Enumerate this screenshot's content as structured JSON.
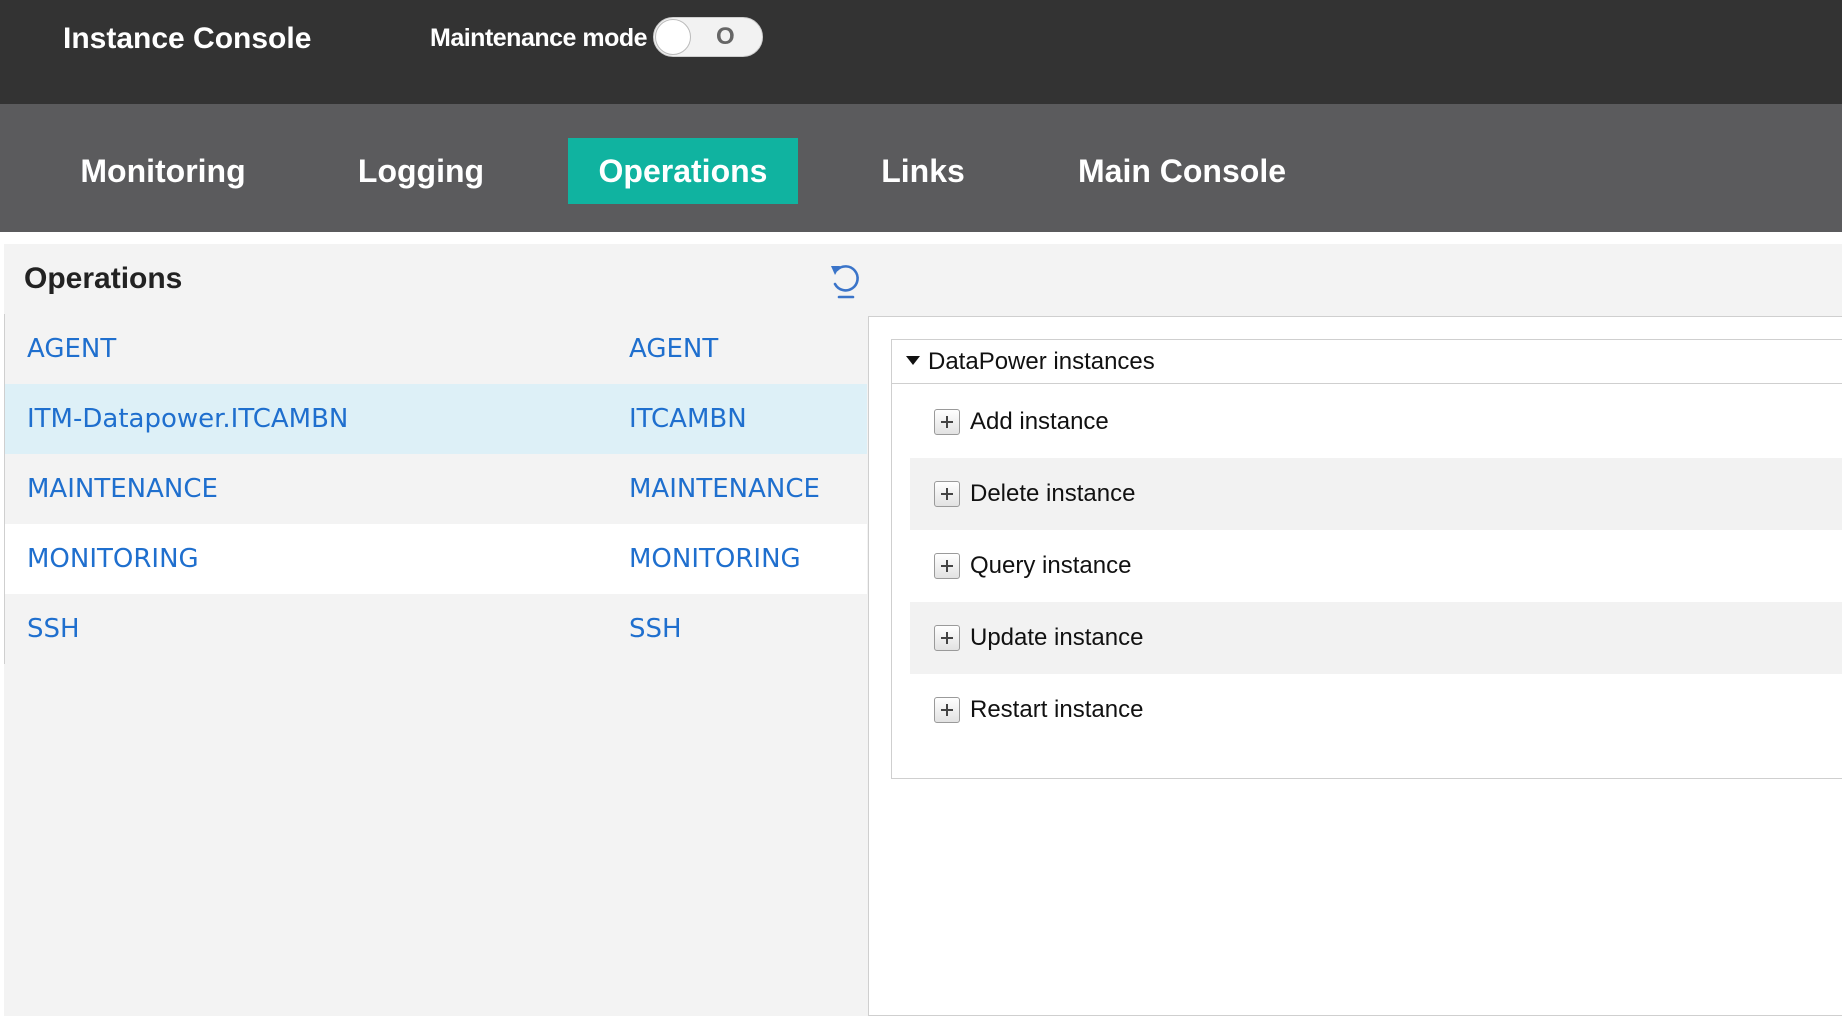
{
  "header": {
    "title": "Instance Console",
    "maintenance_label": "Maintenance mode",
    "maintenance_toggle_state": "O"
  },
  "nav": {
    "tabs": [
      {
        "label": "Monitoring"
      },
      {
        "label": "Logging"
      },
      {
        "label": "Operations",
        "active": true
      },
      {
        "label": "Links"
      },
      {
        "label": "Main Console"
      }
    ]
  },
  "operations": {
    "title": "Operations",
    "rows": [
      {
        "name": "AGENT",
        "group": "AGENT"
      },
      {
        "name": "ITM-Datapower.ITCAMBN",
        "group": "ITCAMBN",
        "selected": true
      },
      {
        "name": "MAINTENANCE",
        "group": "MAINTENANCE"
      },
      {
        "name": "MONITORING",
        "group": "MONITORING"
      },
      {
        "name": "SSH",
        "group": "SSH"
      }
    ]
  },
  "detail": {
    "group_title": "DataPower instances",
    "actions": [
      {
        "label": "Add instance"
      },
      {
        "label": "Delete instance"
      },
      {
        "label": "Query instance"
      },
      {
        "label": "Update instance"
      },
      {
        "label": "Restart instance"
      }
    ]
  },
  "colors": {
    "topbar": "#333333",
    "navbar": "#5b5b5d",
    "active_tab": "#10b3a0",
    "link": "#1f6fce",
    "selected_row": "#ddf0f7"
  }
}
